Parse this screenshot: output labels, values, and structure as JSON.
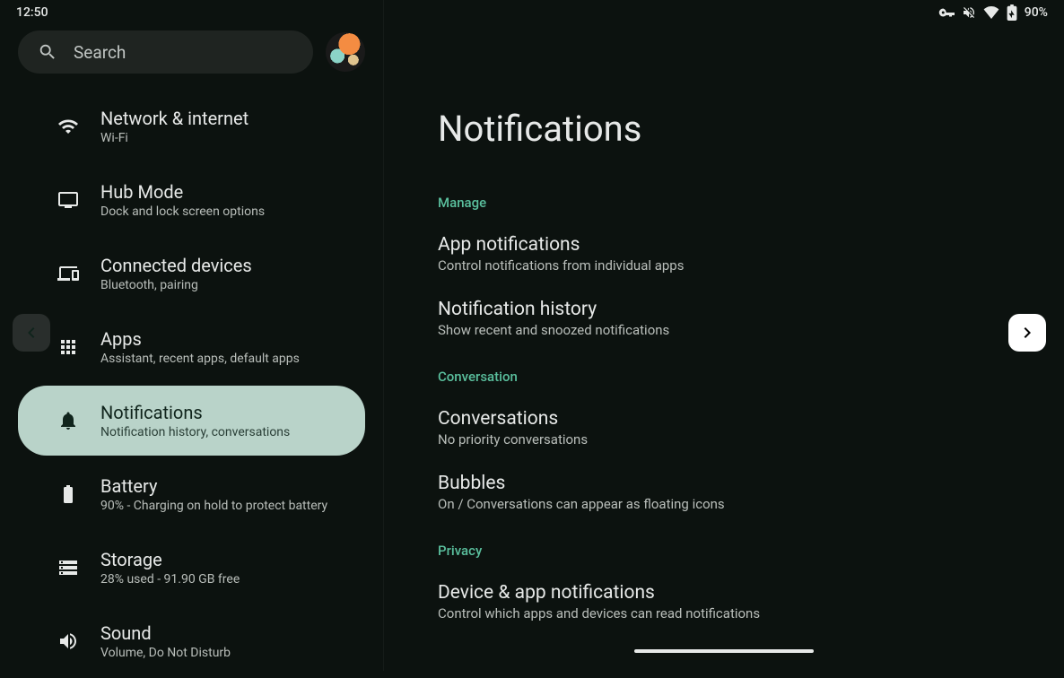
{
  "statusbar": {
    "time": "12:50",
    "battery_pct": "90%"
  },
  "search": {
    "placeholder": "Search"
  },
  "sidebar": {
    "items": [
      {
        "id": "network",
        "icon": "wifi",
        "title": "Network & internet",
        "sub": "Wi-Fi"
      },
      {
        "id": "hubmode",
        "icon": "dock",
        "title": "Hub Mode",
        "sub": "Dock and lock screen options"
      },
      {
        "id": "connected",
        "icon": "devices",
        "title": "Connected devices",
        "sub": "Bluetooth, pairing"
      },
      {
        "id": "apps",
        "icon": "apps",
        "title": "Apps",
        "sub": "Assistant, recent apps, default apps"
      },
      {
        "id": "notifications",
        "icon": "bell",
        "title": "Notifications",
        "sub": "Notification history, conversations"
      },
      {
        "id": "battery",
        "icon": "battery",
        "title": "Battery",
        "sub": "90% - Charging on hold to protect battery"
      },
      {
        "id": "storage",
        "icon": "storage",
        "title": "Storage",
        "sub": "28% used - 91.90 GB free"
      },
      {
        "id": "sound",
        "icon": "sound",
        "title": "Sound",
        "sub": "Volume, Do Not Disturb"
      }
    ],
    "selected_index": 4
  },
  "page": {
    "title": "Notifications",
    "sections": [
      {
        "header": "Manage",
        "items": [
          {
            "title": "App notifications",
            "sub": "Control notifications from individual apps"
          },
          {
            "title": "Notification history",
            "sub": "Show recent and snoozed notifications"
          }
        ]
      },
      {
        "header": "Conversation",
        "items": [
          {
            "title": "Conversations",
            "sub": "No priority conversations"
          },
          {
            "title": "Bubbles",
            "sub": "On / Conversations can appear as floating icons"
          }
        ]
      },
      {
        "header": "Privacy",
        "items": [
          {
            "title": "Device & app notifications",
            "sub": "Control which apps and devices can read notifications"
          }
        ]
      }
    ]
  }
}
